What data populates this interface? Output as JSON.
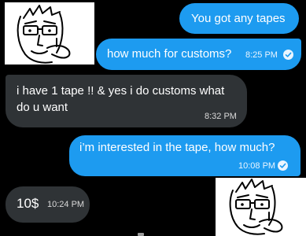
{
  "conversation": {
    "messages": [
      {
        "direction": "sent",
        "text": "You got any tapes"
      },
      {
        "direction": "sent",
        "text": "how much for customs?",
        "time": "8:25 PM",
        "status_icon": "read-check-icon"
      },
      {
        "direction": "received",
        "text": "i have 1 tape !! & yes i do customs what do u want",
        "time": "8:32 PM"
      },
      {
        "direction": "sent",
        "text": "i’m interested in the tape, how much?",
        "time": "10:08 PM",
        "status_icon": "read-check-icon"
      },
      {
        "direction": "received",
        "text": "10$",
        "time": "10:24 PM"
      }
    ],
    "stickers": [
      {
        "name": "smug-meme-face-sticker"
      },
      {
        "name": "smug-meme-face-sticker"
      }
    ]
  },
  "colors": {
    "background": "#000000",
    "sent_bubble": "#1d9bf0",
    "received_bubble": "#2f3336",
    "text": "#ffffff"
  }
}
